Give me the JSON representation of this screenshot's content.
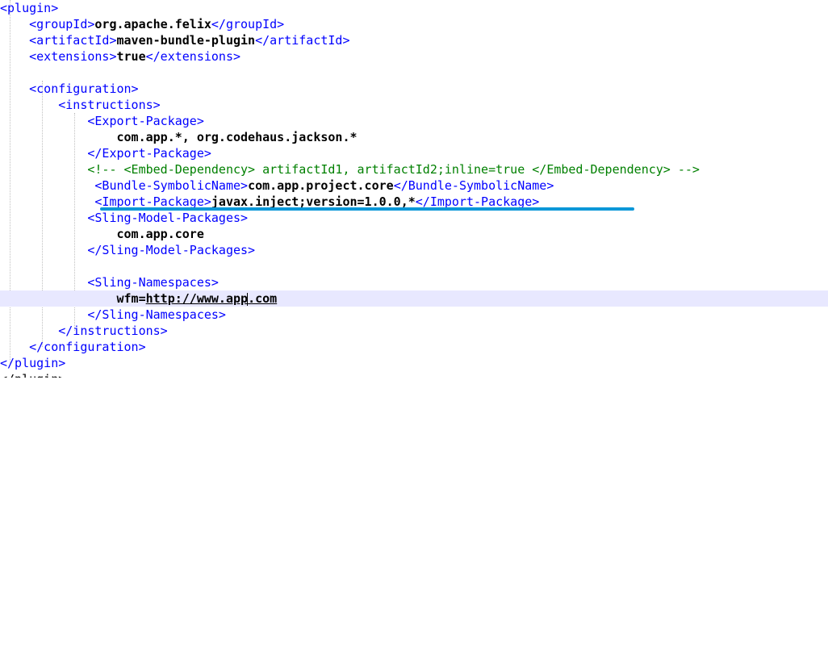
{
  "editor": {
    "current_line": 18,
    "lines": [
      [
        {
          "t": "<plugin>",
          "c": "tag"
        }
      ],
      [
        {
          "t": "    "
        },
        {
          "t": "<groupId>",
          "c": "tag"
        },
        {
          "t": "org.apache.felix",
          "c": "bold"
        },
        {
          "t": "</groupId>",
          "c": "tag"
        }
      ],
      [
        {
          "t": "    "
        },
        {
          "t": "<artifactId>",
          "c": "tag"
        },
        {
          "t": "maven-bundle-plugin",
          "c": "bold"
        },
        {
          "t": "</artifactId>",
          "c": "tag"
        }
      ],
      [
        {
          "t": "    "
        },
        {
          "t": "<extensions>",
          "c": "tag"
        },
        {
          "t": "true",
          "c": "bold"
        },
        {
          "t": "</extensions>",
          "c": "tag"
        }
      ],
      [],
      [
        {
          "t": "    "
        },
        {
          "t": "<configuration>",
          "c": "tag"
        }
      ],
      [
        {
          "t": "        "
        },
        {
          "t": "<instructions>",
          "c": "tag"
        }
      ],
      [
        {
          "t": "            "
        },
        {
          "t": "<Export-Package>",
          "c": "tag"
        }
      ],
      [
        {
          "t": "                "
        },
        {
          "t": "com.app.*, org.codehaus.jackson.*",
          "c": "bold"
        }
      ],
      [
        {
          "t": "            "
        },
        {
          "t": "</Export-Package>",
          "c": "tag"
        }
      ],
      [
        {
          "t": "            "
        },
        {
          "t": "<!-- <Embed-Dependency> artifactId1, artifactId2;inline=true </Embed-Dependency> -->",
          "c": "comment"
        }
      ],
      [
        {
          "t": "             "
        },
        {
          "t": "<Bundle-SymbolicName>",
          "c": "tag"
        },
        {
          "t": "com.app.project.core",
          "c": "bold"
        },
        {
          "t": "</Bundle-SymbolicName>",
          "c": "tag"
        }
      ],
      [
        {
          "t": "             "
        },
        {
          "t": "<Import-Package>",
          "c": "tag"
        },
        {
          "t": "javax.inject;version=1.0.0,*",
          "c": "bold"
        },
        {
          "t": "</Import-Package>",
          "c": "tag"
        }
      ],
      [
        {
          "t": "            "
        },
        {
          "t": "<Sling-Model-Packages>",
          "c": "tag"
        }
      ],
      [
        {
          "t": "                "
        },
        {
          "t": "com.app.core",
          "c": "bold"
        }
      ],
      [
        {
          "t": "            "
        },
        {
          "t": "</Sling-Model-Packages>",
          "c": "tag"
        }
      ],
      [],
      [
        {
          "t": "            "
        },
        {
          "t": "<Sling-Namespaces>",
          "c": "tag"
        }
      ],
      [
        {
          "t": "                "
        },
        {
          "t": "wfm=",
          "c": "bold"
        },
        {
          "t": "http://www.app",
          "c": "url"
        },
        {
          "t": "",
          "c": "caret"
        },
        {
          "t": ".com",
          "c": "url"
        }
      ],
      [
        {
          "t": "            "
        },
        {
          "t": "</Sling-Namespaces>",
          "c": "tag"
        }
      ],
      [
        {
          "t": "        "
        },
        {
          "t": "</instructions>",
          "c": "tag"
        }
      ],
      [
        {
          "t": "    "
        },
        {
          "t": "</configuration>",
          "c": "tag"
        }
      ],
      [
        {
          "t": "</plugin>",
          "c": "tag"
        }
      ]
    ],
    "partial_line": "</plugin>"
  },
  "annotation": {
    "color": "#0a97d8"
  }
}
